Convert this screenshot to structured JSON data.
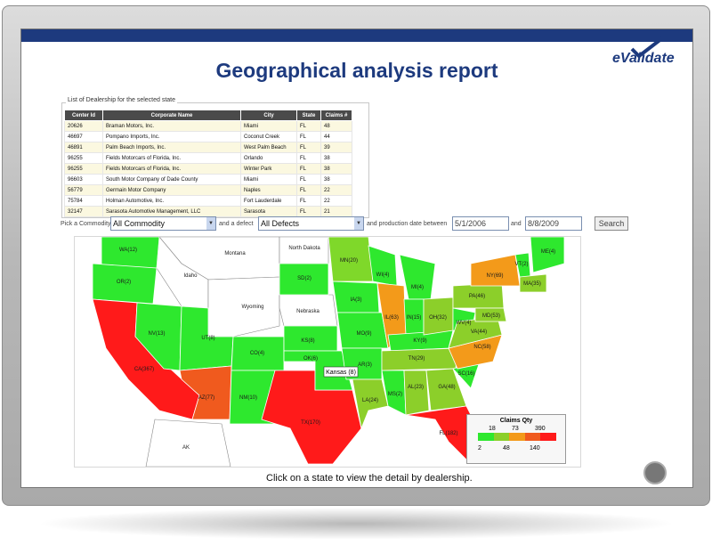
{
  "page": {
    "title": "Geographical analysis report",
    "logo_text": "eValidate"
  },
  "dealers": {
    "legend": "List of Dealership for the selected state",
    "columns": [
      "Center Id",
      "Corporate Name",
      "City",
      "State",
      "Claims #"
    ],
    "rows": [
      [
        "20626",
        "Braman Motors, Inc.",
        "Miami",
        "FL",
        "48"
      ],
      [
        "46697",
        "Pompano Imports, Inc.",
        "Coconut Creek",
        "FL",
        "44"
      ],
      [
        "46891",
        "Palm Beach Imports, Inc.",
        "West Palm Beach",
        "FL",
        "39"
      ],
      [
        "96255",
        "Fields Motorcars of Florida, Inc.",
        "Orlando",
        "FL",
        "38"
      ],
      [
        "96255",
        "Fields Motorcars of Florida, Inc.",
        "Winter Park",
        "FL",
        "38"
      ],
      [
        "96603",
        "South Motor Company of Dade County",
        "Miami",
        "FL",
        "38"
      ],
      [
        "56779",
        "Germain Motor Company",
        "Naples",
        "FL",
        "22"
      ],
      [
        "75784",
        "Holman Automotive, Inc.",
        "Fort Lauderdale",
        "FL",
        "22"
      ],
      [
        "32147",
        "Sarasota Automotive Management, LLC",
        "Sarasota",
        "FL",
        "21"
      ]
    ]
  },
  "filters": {
    "commodity_label": "Pick a Commodity",
    "commodity_value": "All Commodity",
    "defect_label": "and a defect",
    "defect_value": "All Defects",
    "date_label": "and production date  between",
    "start_date": "5/1/2006",
    "and_label": "and",
    "end_date": "8/8/2009",
    "search_label": "Search"
  },
  "map": {
    "caption": "Click on a state to view the detail by dealership.",
    "tooltip": "Kansas (8)",
    "states": [
      {
        "label": "WA(12)",
        "color": "#2ee82e"
      },
      {
        "label": "OR(2)",
        "color": "#2ee82e"
      },
      {
        "label": "CA(367)",
        "color": "#ff1a1a"
      },
      {
        "label": "NV(13)",
        "color": "#2ee82e"
      },
      {
        "label": "UT(8)",
        "color": "#2ee82e"
      },
      {
        "label": "AZ(77)",
        "color": "#f05a1e"
      },
      {
        "label": "CO(4)",
        "color": "#2ee82e"
      },
      {
        "label": "NM(10)",
        "color": "#2ee82e"
      },
      {
        "label": "TX(170)",
        "color": "#ff1a1a"
      },
      {
        "label": "SD(2)",
        "color": "#2ee82e"
      },
      {
        "label": "KS(8)",
        "color": "#2ee82e"
      },
      {
        "label": "OK(6)",
        "color": "#2ee82e"
      },
      {
        "label": "MN(20)",
        "color": "#7fd82a"
      },
      {
        "label": "IA(3)",
        "color": "#2ee82e"
      },
      {
        "label": "MO(9)",
        "color": "#2ee82e"
      },
      {
        "label": "AR(3)",
        "color": "#2ee82e"
      },
      {
        "label": "LA(24)",
        "color": "#8ccf2a"
      },
      {
        "label": "WI(4)",
        "color": "#2ee82e"
      },
      {
        "label": "IL(63)",
        "color": "#f39a1a"
      },
      {
        "label": "MS(2)",
        "color": "#2ee82e"
      },
      {
        "label": "MI(4)",
        "color": "#2ee82e"
      },
      {
        "label": "IN(15)",
        "color": "#2ee82e"
      },
      {
        "label": "KY(9)",
        "color": "#2ee82e"
      },
      {
        "label": "TN(29)",
        "color": "#8ccf2a"
      },
      {
        "label": "AL(23)",
        "color": "#8ccf2a"
      },
      {
        "label": "OH(32)",
        "color": "#8ccf2a"
      },
      {
        "label": "GA(48)",
        "color": "#8ccf2a"
      },
      {
        "label": "FL(182)",
        "color": "#ff1a1a"
      },
      {
        "label": "WV(4)",
        "color": "#2ee82e"
      },
      {
        "label": "SC(16)",
        "color": "#2ee82e"
      },
      {
        "label": "NC(58)",
        "color": "#f39a1a"
      },
      {
        "label": "VA(44)",
        "color": "#8ccf2a"
      },
      {
        "label": "PA(46)",
        "color": "#8ccf2a"
      },
      {
        "label": "MD(53)",
        "color": "#8ccf2a"
      },
      {
        "label": "NY(69)",
        "color": "#f39a1a"
      },
      {
        "label": "VT(2)",
        "color": "#2ee82e"
      },
      {
        "label": "MA(35)",
        "color": "#8ccf2a"
      },
      {
        "label": "ME(4)",
        "color": "#2ee82e"
      }
    ],
    "unlabeled": [
      "Montana",
      "North Dakota",
      "Idaho",
      "Wyoming",
      "Nebraska",
      "AK"
    ]
  },
  "legend": {
    "title": "Claims Qty",
    "top_values": [
      "18",
      "73",
      "390"
    ],
    "bottom_values": [
      "2",
      "48",
      "140"
    ],
    "colors": [
      "#2ee82e",
      "#8ccf2a",
      "#f39a1a",
      "#f05a1e",
      "#ff1a1a"
    ]
  }
}
